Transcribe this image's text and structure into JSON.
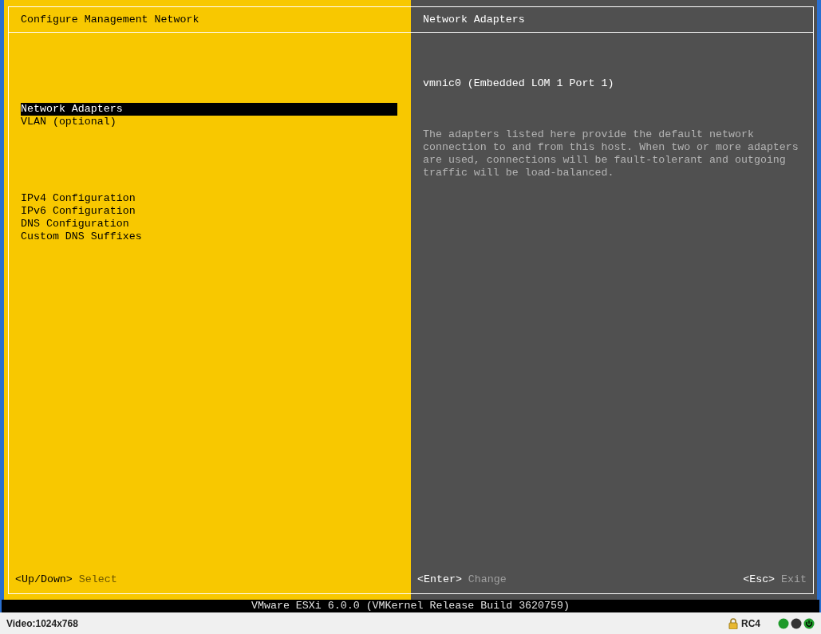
{
  "left_panel": {
    "title": "Configure Management Network",
    "menu_groups": [
      {
        "items": [
          {
            "label": "Network Adapters",
            "selected": true
          },
          {
            "label": "VLAN (optional)",
            "selected": false
          }
        ]
      },
      {
        "items": [
          {
            "label": "IPv4 Configuration",
            "selected": false
          },
          {
            "label": "IPv6 Configuration",
            "selected": false
          },
          {
            "label": "DNS Configuration",
            "selected": false
          },
          {
            "label": "Custom DNS Suffixes",
            "selected": false
          }
        ]
      }
    ],
    "hints": [
      {
        "key": "<Up/Down>",
        "action": "Select"
      }
    ]
  },
  "right_panel": {
    "title": "Network Adapters",
    "adapter": "vmnic0 (Embedded LOM 1 Port 1)",
    "description": "The adapters listed here provide the default network connection to and from this host. When two or more adapters are used, connections will be fault-tolerant and outgoing traffic will be load-balanced.",
    "hints": [
      {
        "key": "<Enter>",
        "action": "Change"
      },
      {
        "key": "<Esc>",
        "action": "Exit"
      }
    ]
  },
  "build_bar": "VMware ESXi 6.0.0 (VMKernel Release Build 3620759)",
  "status_bar": {
    "video": "Video:1024x768",
    "cipher": "RC4"
  }
}
